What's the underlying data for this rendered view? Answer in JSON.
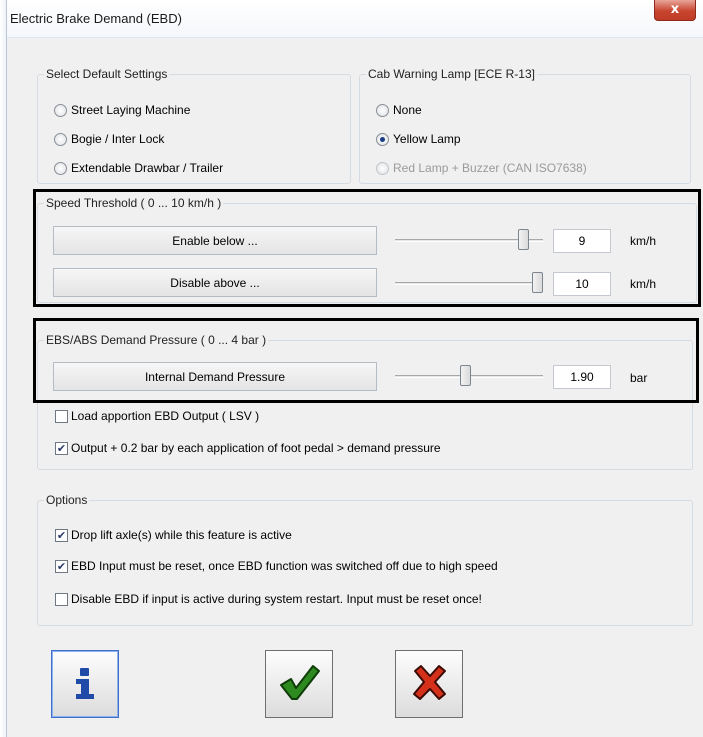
{
  "window": {
    "title": "Electric Brake Demand (EBD)",
    "close_glyph": "x"
  },
  "default_settings": {
    "label": "Select Default Settings",
    "options": [
      "Street Laying Machine",
      "Bogie / Inter Lock",
      "Extendable Drawbar / Trailer"
    ]
  },
  "cab_lamp": {
    "label": "Cab Warning Lamp [ECE R-13]",
    "options": [
      "None",
      "Yellow Lamp",
      "Red Lamp + Buzzer (CAN ISO7638)"
    ],
    "selected": "Yellow Lamp"
  },
  "speed": {
    "label": "Speed Threshold ( 0 ... 10 km/h )",
    "enable_label": "Enable below ...",
    "enable_value": "9",
    "disable_label": "Disable above ...",
    "disable_value": "10",
    "unit": "km/h",
    "max": 10
  },
  "pressure": {
    "label": "EBS/ABS Demand Pressure ( 0 ... 4 bar )",
    "internal_label": "Internal Demand Pressure",
    "value": "1.90",
    "unit": "bar",
    "max": 4
  },
  "load_apportion": {
    "label": "Load apportion EBD Output ( LSV )",
    "checked": false
  },
  "output_boost": {
    "label": "Output + 0.2 bar by each application of foot pedal > demand pressure",
    "checked": true
  },
  "options": {
    "label": "Options",
    "items": [
      {
        "label": "Drop lift axle(s) while this feature is active",
        "checked": true
      },
      {
        "label": "EBD Input must be reset, once EBD function was switched off due to high speed",
        "checked": true
      },
      {
        "label": "Disable EBD if input is active during system restart. Input must be reset once!",
        "checked": false
      }
    ]
  },
  "buttons": {
    "info_icon": "info-icon",
    "ok_icon": "checkmark-icon",
    "cancel_icon": "cross-icon",
    "info_color": "#1f4aa8",
    "ok_color": "#2d8a1e",
    "cancel_color": "#d5301a"
  }
}
